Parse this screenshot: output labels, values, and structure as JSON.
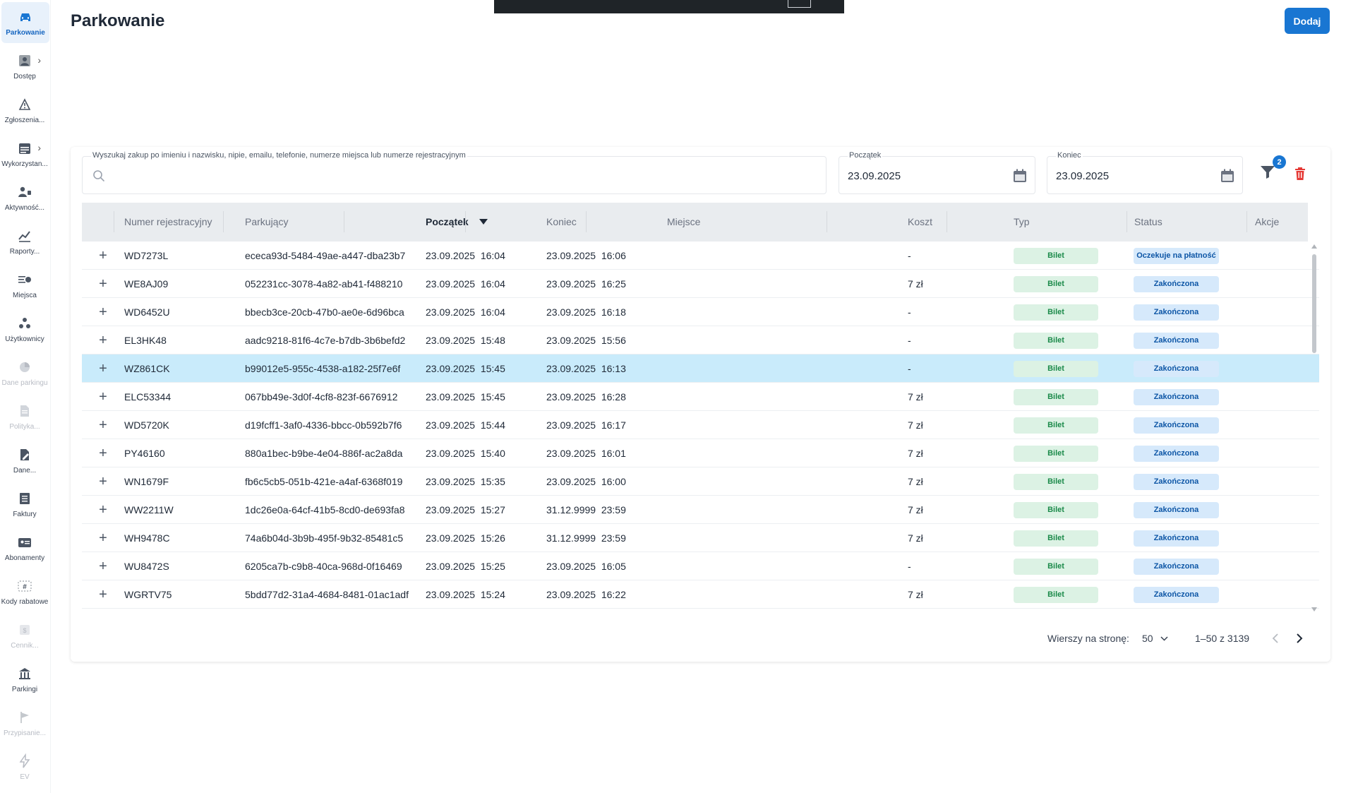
{
  "app": {
    "page_title": "Parkowanie",
    "add_label": "Dodaj"
  },
  "colors": {
    "primary": "#1976d2",
    "row_highlight": "#c9ebfb",
    "type_chip": "#dcf2e4",
    "status_chip": "#d6e9fb",
    "danger": "#e53935"
  },
  "sidebar": {
    "items": [
      {
        "label": "Parkowanie",
        "icon": "car-icon",
        "active": true,
        "disabled": false,
        "chevron": false
      },
      {
        "label": "Dostęp",
        "icon": "person-badge-icon",
        "active": false,
        "disabled": false,
        "chevron": true
      },
      {
        "label": "Zgłoszenia...",
        "icon": "report-icon",
        "active": false,
        "disabled": false,
        "chevron": false
      },
      {
        "label": "Wykorzystan...",
        "icon": "calendar-list-icon",
        "active": false,
        "disabled": false,
        "chevron": true
      },
      {
        "label": "Aktywność...",
        "icon": "activity-icon",
        "active": false,
        "disabled": false,
        "chevron": false
      },
      {
        "label": "Raporty...",
        "icon": "chart-icon",
        "active": false,
        "disabled": false,
        "chevron": false
      },
      {
        "label": "Miejsca",
        "icon": "places-icon",
        "active": false,
        "disabled": false,
        "chevron": false
      },
      {
        "label": "Użytkownicy",
        "icon": "users-icon",
        "active": false,
        "disabled": false,
        "chevron": false
      },
      {
        "label": "Dane parkingu",
        "icon": "pie-icon",
        "active": false,
        "disabled": true,
        "chevron": false
      },
      {
        "label": "Polityka...",
        "icon": "document-icon",
        "active": false,
        "disabled": true,
        "chevron": false
      },
      {
        "label": "Dane...",
        "icon": "edit-document-icon",
        "active": false,
        "disabled": false,
        "chevron": false
      },
      {
        "label": "Faktury",
        "icon": "invoice-icon",
        "active": false,
        "disabled": false,
        "chevron": false
      },
      {
        "label": "Abonamenty",
        "icon": "id-card-icon",
        "active": false,
        "disabled": false,
        "chevron": false
      },
      {
        "label": "Kody rabatowe",
        "icon": "hash-icon",
        "active": false,
        "disabled": false,
        "chevron": false
      },
      {
        "label": "Cennik...",
        "icon": "price-icon",
        "active": false,
        "disabled": true,
        "chevron": false
      },
      {
        "label": "Parkingi",
        "icon": "building-icon",
        "active": false,
        "disabled": false,
        "chevron": false
      },
      {
        "label": "Przypisanie...",
        "icon": "flag-icon",
        "active": false,
        "disabled": true,
        "chevron": false
      },
      {
        "label": "EV",
        "icon": "bolt-icon",
        "active": false,
        "disabled": true,
        "chevron": false
      }
    ]
  },
  "filters": {
    "search_label": "Wyszukaj zakup po imieniu i nazwisku, nipie, emailu, telefonie, numerze miejsca lub numerze rejestracyjnym",
    "search_value": "",
    "start_label": "Początek",
    "start_value": "23.09.2025",
    "end_label": "Koniec",
    "end_value": "23.09.2025",
    "active_filter_count": "2"
  },
  "table": {
    "columns": [
      "Numer rejestracyjny",
      "Parkujący",
      "Początek",
      "Koniec",
      "Miejsce",
      "Koszt",
      "Typ",
      "Status",
      "Akcje"
    ],
    "rows": [
      {
        "plate": "WD7273L",
        "parker": "ececa93d-5484-49ae-a447-dba23b7",
        "start": "23.09.2025  16:04",
        "end": "23.09.2025  16:06",
        "place": "",
        "cost": "-",
        "type": "Bilet",
        "status": "Oczekuje na płatność",
        "highlight": false
      },
      {
        "plate": "WE8AJ09",
        "parker": "052231cc-3078-4a82-ab41-f488210",
        "start": "23.09.2025  16:04",
        "end": "23.09.2025  16:25",
        "place": "",
        "cost": "7 zł",
        "type": "Bilet",
        "status": "Zakończona",
        "highlight": false
      },
      {
        "plate": "WD6452U",
        "parker": "bbecb3ce-20cb-47b0-ae0e-6d96bca",
        "start": "23.09.2025  16:04",
        "end": "23.09.2025  16:18",
        "place": "",
        "cost": "-",
        "type": "Bilet",
        "status": "Zakończona",
        "highlight": false
      },
      {
        "plate": "EL3HK48",
        "parker": "aadc9218-81f6-4c7e-b7db-3b6befd2",
        "start": "23.09.2025  15:48",
        "end": "23.09.2025  15:56",
        "place": "",
        "cost": "-",
        "type": "Bilet",
        "status": "Zakończona",
        "highlight": false
      },
      {
        "plate": "WZ861CK",
        "parker": "b99012e5-955c-4538-a182-25f7e6f",
        "start": "23.09.2025  15:45",
        "end": "23.09.2025  16:13",
        "place": "",
        "cost": "-",
        "type": "Bilet",
        "status": "Zakończona",
        "highlight": true
      },
      {
        "plate": "ELC53344",
        "parker": "067bb49e-3d0f-4cf8-823f-6676912",
        "start": "23.09.2025  15:45",
        "end": "23.09.2025  16:28",
        "place": "",
        "cost": "7 zł",
        "type": "Bilet",
        "status": "Zakończona",
        "highlight": false
      },
      {
        "plate": "WD5720K",
        "parker": "d19fcff1-3af0-4336-bbcc-0b592b7f6",
        "start": "23.09.2025  15:44",
        "end": "23.09.2025  16:17",
        "place": "",
        "cost": "7 zł",
        "type": "Bilet",
        "status": "Zakończona",
        "highlight": false
      },
      {
        "plate": "PY46160",
        "parker": "880a1bec-b9be-4e04-886f-ac2a8da",
        "start": "23.09.2025  15:40",
        "end": "23.09.2025  16:01",
        "place": "",
        "cost": "7 zł",
        "type": "Bilet",
        "status": "Zakończona",
        "highlight": false
      },
      {
        "plate": "WN1679F",
        "parker": "fb6c5cb5-051b-421e-a4af-6368f019",
        "start": "23.09.2025  15:35",
        "end": "23.09.2025  16:00",
        "place": "",
        "cost": "7 zł",
        "type": "Bilet",
        "status": "Zakończona",
        "highlight": false
      },
      {
        "plate": "WW2211W",
        "parker": "1dc26e0a-64cf-41b5-8cd0-de693fa8",
        "start": "23.09.2025  15:27",
        "end": "31.12.9999  23:59",
        "place": "",
        "cost": "7 zł",
        "type": "Bilet",
        "status": "Zakończona",
        "highlight": false
      },
      {
        "plate": "WH9478C",
        "parker": "74a6b04d-3b9b-495f-9b32-85481c5",
        "start": "23.09.2025  15:26",
        "end": "31.12.9999  23:59",
        "place": "",
        "cost": "7 zł",
        "type": "Bilet",
        "status": "Zakończona",
        "highlight": false
      },
      {
        "plate": "WU8472S",
        "parker": "6205ca7b-c9b8-40ca-968d-0f16469",
        "start": "23.09.2025  15:25",
        "end": "23.09.2025  16:05",
        "place": "",
        "cost": "-",
        "type": "Bilet",
        "status": "Zakończona",
        "highlight": false
      },
      {
        "plate": "WGRTV75",
        "parker": "5bdd77d2-31a4-4684-8481-01ac1adf",
        "start": "23.09.2025  15:24",
        "end": "23.09.2025  16:22",
        "place": "",
        "cost": "7 zł",
        "type": "Bilet",
        "status": "Zakończona",
        "highlight": false
      }
    ]
  },
  "pagination": {
    "rows_per_page_label": "Wierszy na stronę:",
    "rows_per_page": "50",
    "range": "1–50 z 3139"
  }
}
